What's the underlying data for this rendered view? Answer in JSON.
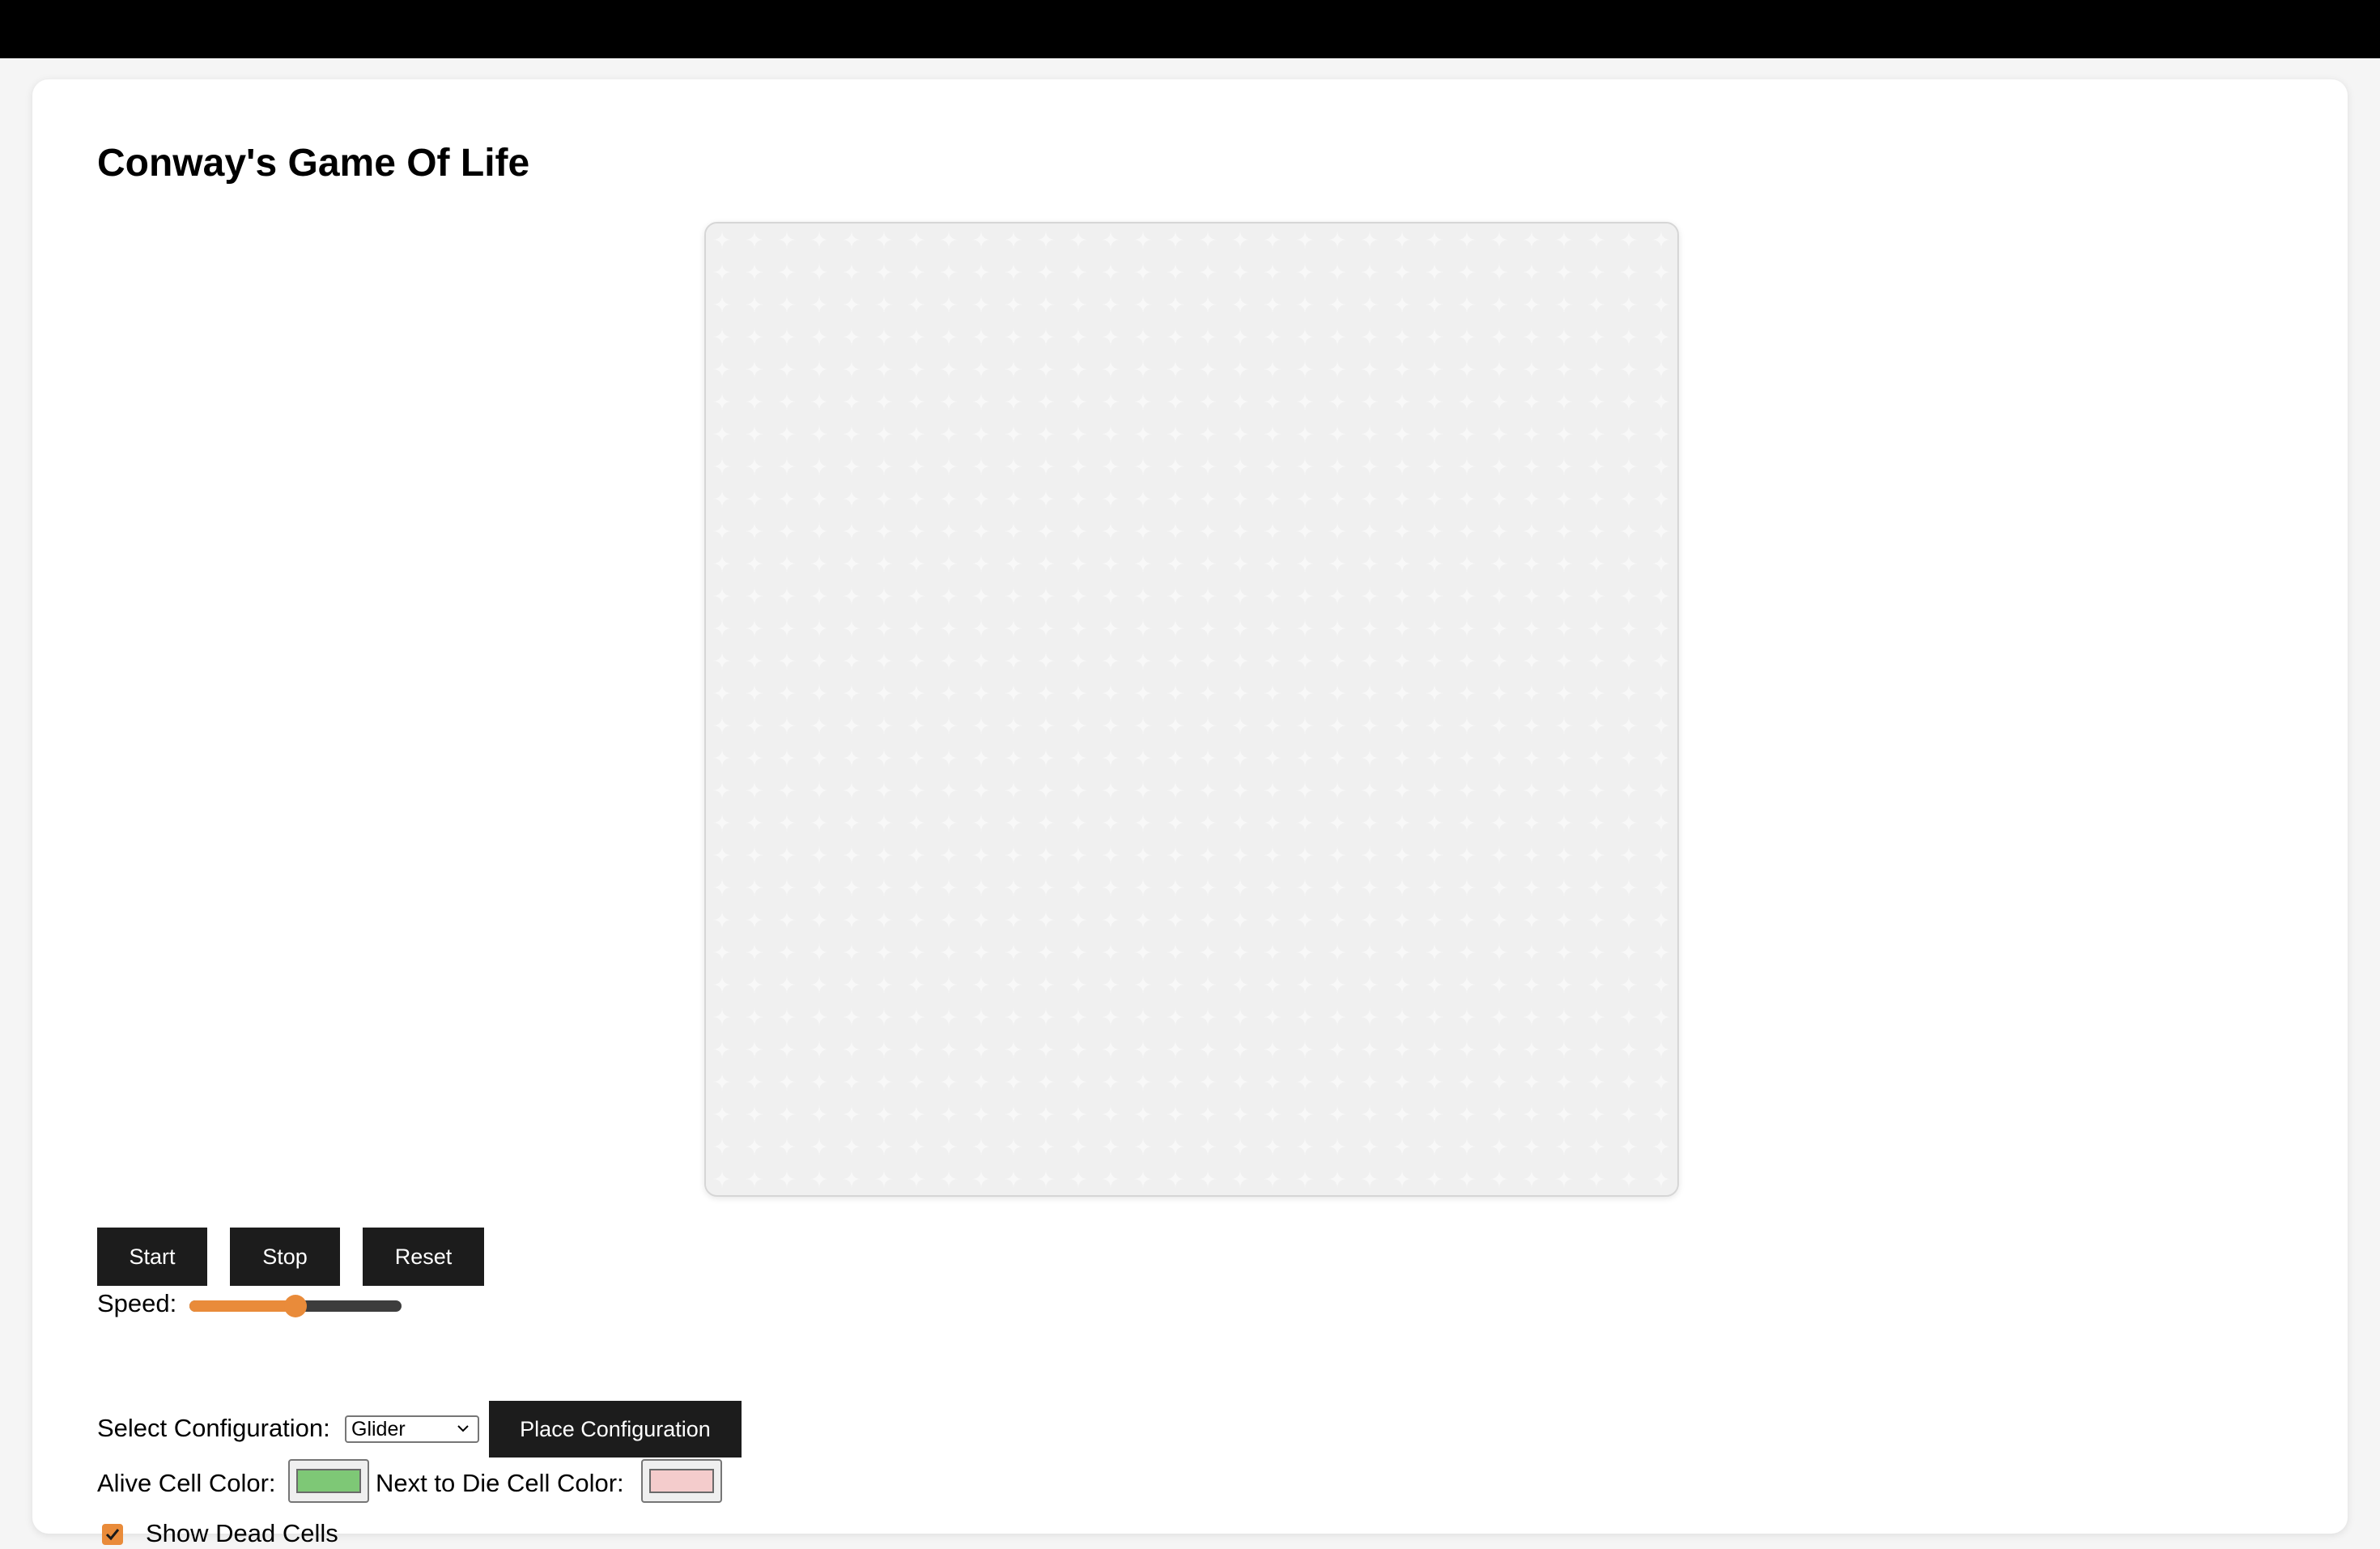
{
  "page": {
    "title": "Conway's Game Of Life"
  },
  "controls": {
    "start_label": "Start",
    "stop_label": "Stop",
    "reset_label": "Reset",
    "speed_label": "Speed:",
    "speed_value_fraction": 0.5,
    "config_label": "Select Configuration:",
    "config_selected": "Glider",
    "place_label": "Place Configuration",
    "alive_color_label": "Alive Cell Color:",
    "alive_color": "#7ec876",
    "next_die_label": "Next to Die Cell Color:",
    "next_die_color": "#f4cccc",
    "show_dead_label": "Show Dead Cells",
    "show_dead_checked": true
  },
  "icons": {
    "select_chevron": "chevron-down-icon",
    "checkbox_check": "check-icon"
  },
  "colors": {
    "button_bg": "#1c1c1c",
    "accent": "#e98b3a",
    "board_bg": "#f0f0f0",
    "dead_cell": "#f8f8f8"
  }
}
